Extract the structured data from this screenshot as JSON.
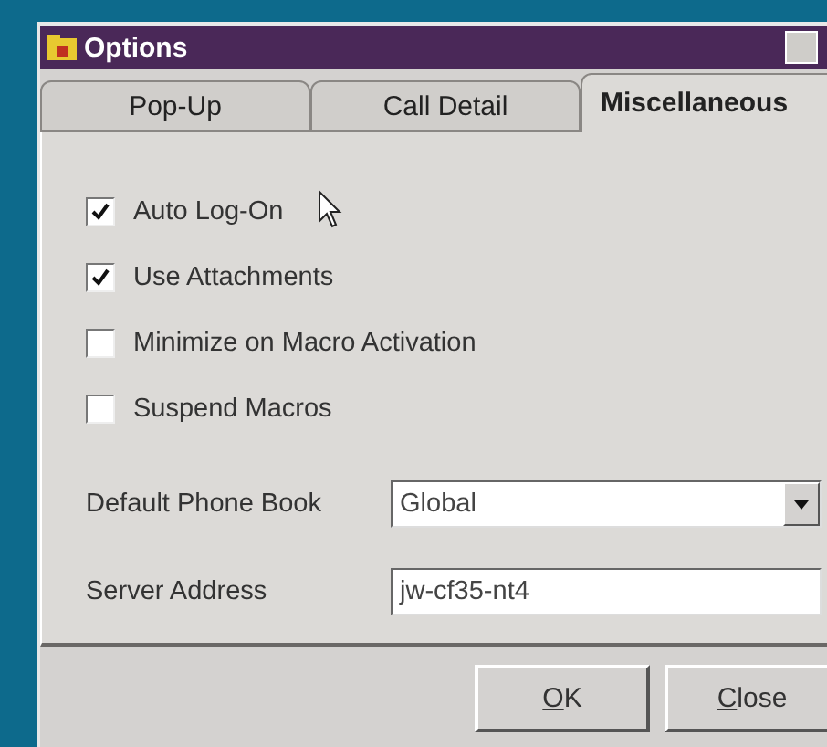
{
  "window": {
    "title": "Options"
  },
  "tabs": [
    {
      "label": "Pop-Up",
      "selected": false
    },
    {
      "label": "Call Detail",
      "selected": false
    },
    {
      "label": "Miscellaneous",
      "selected": true
    }
  ],
  "options": [
    {
      "label": "Auto Log-On",
      "checked": true
    },
    {
      "label": "Use Attachments",
      "checked": true
    },
    {
      "label": "Minimize on Macro Activation",
      "checked": false
    },
    {
      "label": "Suspend Macros",
      "checked": false
    }
  ],
  "fields": [
    {
      "kind": "dropdown",
      "label": "Default Phone Book",
      "value": "Global"
    },
    {
      "kind": "text",
      "label": "Server Address",
      "value": "jw-cf35-nt4"
    }
  ],
  "buttons": [
    "OK",
    "Close"
  ]
}
